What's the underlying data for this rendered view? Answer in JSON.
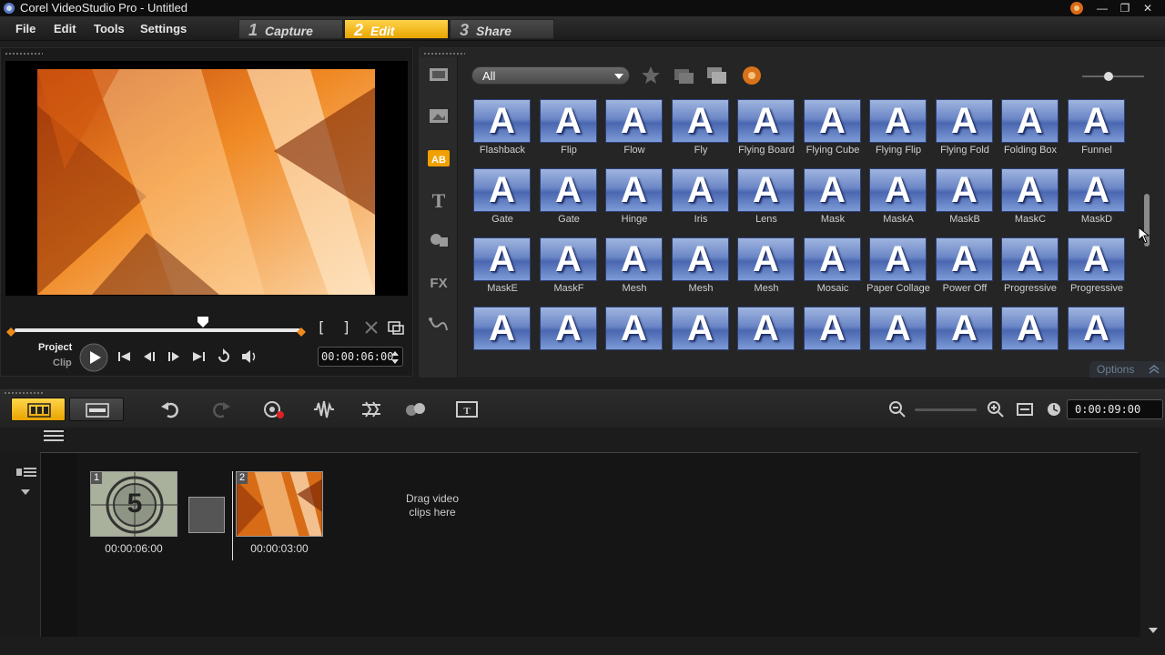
{
  "window": {
    "title": "Corel VideoStudio Pro - Untitled"
  },
  "menu": [
    "File",
    "Edit",
    "Tools",
    "Settings"
  ],
  "steps": [
    {
      "num": "1",
      "label": "Capture",
      "active": false
    },
    {
      "num": "2",
      "label": "Edit",
      "active": true
    },
    {
      "num": "3",
      "label": "Share",
      "active": false
    }
  ],
  "preview": {
    "mode_project": "Project",
    "mode_clip": "Clip",
    "timecode": "00:00:06:00",
    "mark_in": "[",
    "mark_out": "]"
  },
  "library": {
    "category": "All",
    "options_label": "Options",
    "transitions": [
      "Flashback",
      "Flip",
      "Flow",
      "Fly",
      "Flying Board",
      "Flying Cube",
      "Flying Flip",
      "Flying Fold",
      "Folding Box",
      "Funnel",
      "Gate",
      "Gate",
      "Hinge",
      "Iris",
      "Lens",
      "Mask",
      "MaskA",
      "MaskB",
      "MaskC",
      "MaskD",
      "MaskE",
      "MaskF",
      "Mesh",
      "Mesh",
      "Mesh",
      "Mosaic",
      "Paper Collage",
      "Power Off",
      "Progressive",
      "Progressive",
      "",
      "",
      "",
      "",
      "",
      "",
      "",
      "",
      "",
      ""
    ],
    "thumb_letter": "A"
  },
  "timeline": {
    "duration": "0:00:09:00",
    "clips": [
      {
        "num": "1",
        "duration": "00:00:06:00",
        "kind": "countdown",
        "countdown_digit": "5"
      },
      {
        "num": "2",
        "duration": "00:00:03:00",
        "kind": "video"
      }
    ],
    "drag_hint": "Drag video clips here"
  },
  "colors": {
    "accent": "#f0b000",
    "thumb_blue": "#6b86c6",
    "panel_bg": "#252525"
  }
}
